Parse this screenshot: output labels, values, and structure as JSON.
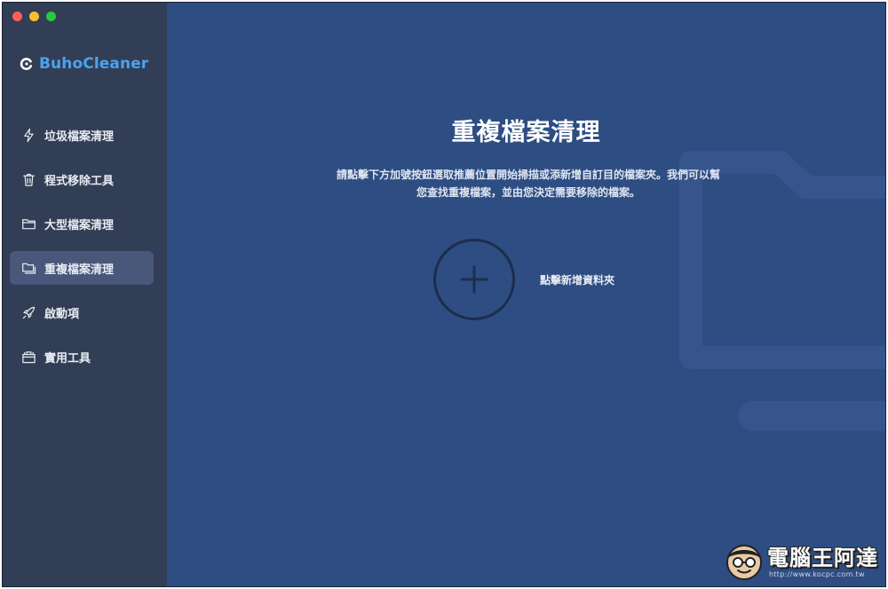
{
  "app": {
    "name": "BuhoCleaner"
  },
  "sidebar": {
    "items": [
      {
        "label": "垃圾檔案清理",
        "icon": "lightning-icon",
        "active": false
      },
      {
        "label": "程式移除工具",
        "icon": "trash-icon",
        "active": false
      },
      {
        "label": "大型檔案清理",
        "icon": "folder-icon",
        "active": false
      },
      {
        "label": "重複檔案清理",
        "icon": "duplicate-folder-icon",
        "active": true
      },
      {
        "label": "啟動項",
        "icon": "rocket-icon",
        "active": false
      },
      {
        "label": "實用工具",
        "icon": "toolbox-icon",
        "active": false
      }
    ]
  },
  "main": {
    "title": "重複檔案清理",
    "description": "請點擊下方加號按鈕選取推薦位置開始掃描或添新增自訂目的檔案夾。我們可以幫您查找重複檔案，並由您決定需要移除的檔案。",
    "add_label": "點擊新增資料夾"
  },
  "watermark": {
    "title": "電腦王阿達",
    "url": "http://www.kocpc.com.tw"
  },
  "colors": {
    "sidebar_bg": "#323e55",
    "main_bg": "#2e4d82",
    "brand": "#4aa3f0",
    "active_item": "#48577a"
  }
}
